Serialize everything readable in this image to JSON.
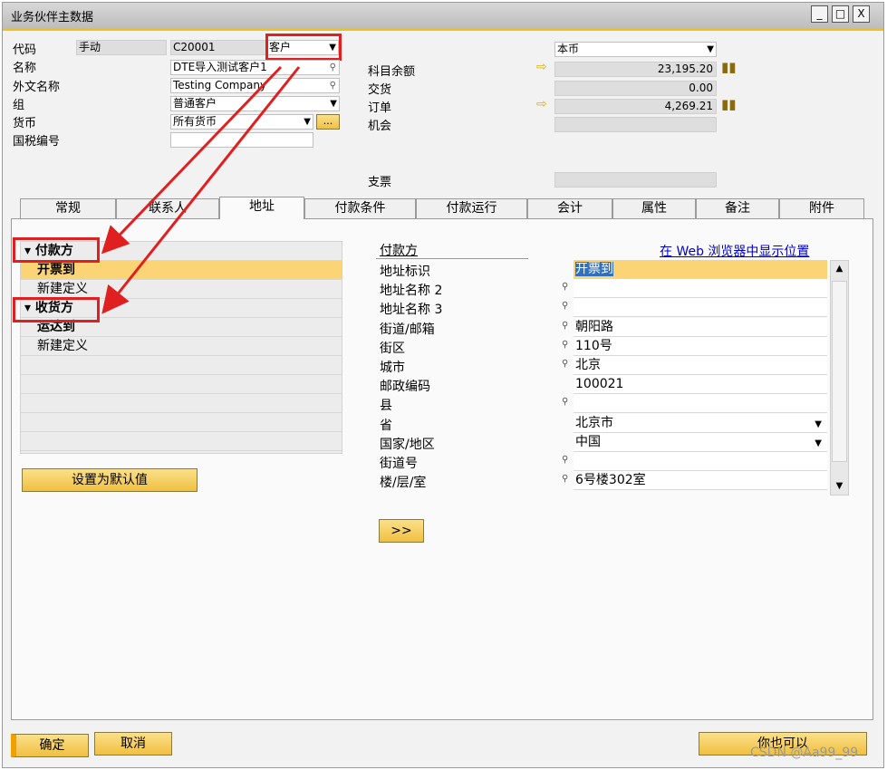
{
  "window": {
    "title": "业务伙伴主数据",
    "minimize": "_",
    "maximize": "□",
    "close": "X"
  },
  "header": {
    "code_label": "代码",
    "series_value": "手动",
    "code_value": "C20001",
    "type_value": "客户",
    "name_label": "名称",
    "name_value": "DTE导入测试客户1",
    "foreign_name_label": "外文名称",
    "foreign_name_value": "Testing Company",
    "group_label": "组",
    "group_value": "普通客户",
    "currency_label": "货币",
    "currency_value": "所有货币",
    "currency_more": "...",
    "tax_label": "国税编号",
    "tax_value": ""
  },
  "balances": {
    "currency_select": "本币",
    "account_balance_label": "科目余额",
    "account_balance_value": "23,195.20",
    "deliveries_label": "交货",
    "deliveries_value": "0.00",
    "orders_label": "订单",
    "orders_value": "4,269.21",
    "opportunities_label": "机会",
    "opportunities_value": "",
    "checks_label": "支票",
    "checks_value": ""
  },
  "tabs": [
    "常规",
    "联系人",
    "地址",
    "付款条件",
    "付款运行",
    "会计",
    "属性",
    "备注",
    "附件"
  ],
  "active_tab": "地址",
  "address_tree": {
    "pay_to_label": "付款方",
    "pay_to_items": [
      "开票到",
      "新建定义"
    ],
    "ship_to_label": "收货方",
    "ship_to_items": [
      "运达到",
      "新建定义"
    ]
  },
  "set_default_button": "设置为默认值",
  "detail": {
    "section_title": "付款方",
    "web_link": "在 Web 浏览器中显示位置",
    "fields": [
      {
        "label": "地址标识",
        "value": "开票到"
      },
      {
        "label": "地址名称 2",
        "value": ""
      },
      {
        "label": "地址名称 3",
        "value": ""
      },
      {
        "label": "街道/邮箱",
        "value": "朝阳路"
      },
      {
        "label": "街区",
        "value": "110号"
      },
      {
        "label": "城市",
        "value": "北京"
      },
      {
        "label": "邮政编码",
        "value": "100021"
      },
      {
        "label": "县",
        "value": ""
      },
      {
        "label": "省",
        "value": "北京市"
      },
      {
        "label": "国家/地区",
        "value": "中国"
      },
      {
        "label": "街道号",
        "value": ""
      },
      {
        "label": "楼/层/室",
        "value": "6号楼302室"
      }
    ],
    "copy_button": ">>"
  },
  "footer": {
    "ok_button": "确定",
    "cancel_button": "取消",
    "also_button": "你也可以",
    "watermark": "CSDN @Aa99_99"
  },
  "colors": {
    "accent": "#f0c020",
    "highlight": "#fbd575",
    "annotation": "#e02020",
    "link": "#0000cc"
  }
}
